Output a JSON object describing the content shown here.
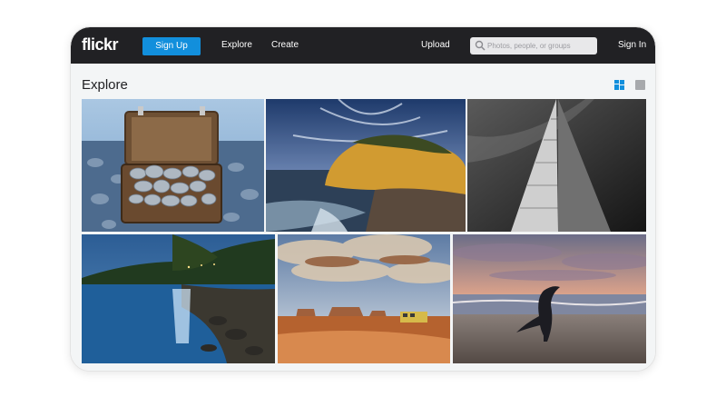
{
  "header": {
    "logo": "flickr",
    "signup_label": "Sign Up",
    "nav": {
      "explore": "Explore",
      "create": "Create",
      "upload": "Upload"
    },
    "search_placeholder": "Photos, people, or groups",
    "signin_label": "Sign In"
  },
  "page": {
    "title": "Explore"
  },
  "colors": {
    "topbar": "#212124",
    "accent": "#128fdc",
    "background": "#f3f5f6"
  },
  "icons": [
    "search-icon",
    "grid-view-icon",
    "single-view-icon"
  ],
  "photos": [
    "suitcase-stones-photo",
    "cliff-sunset-photo",
    "skyscraper-bw-photo",
    "blue-bay-night-photo",
    "desert-bus-photo",
    "beach-dancer-photo"
  ]
}
